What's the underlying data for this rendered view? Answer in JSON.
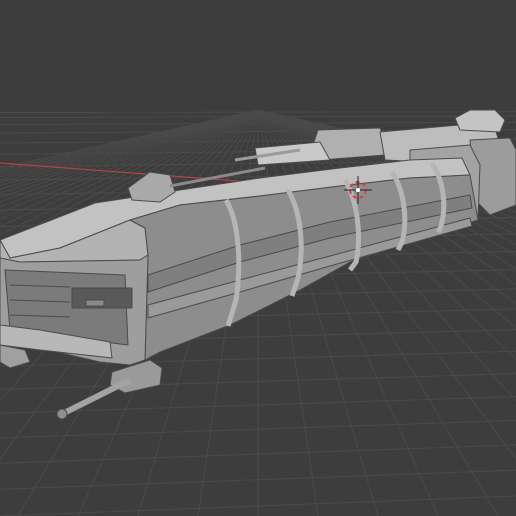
{
  "viewport": {
    "background_color": "#3d3d3d",
    "grid_color": "#4a4a4a",
    "x_axis_color": "#b8404a",
    "y_axis_color": "#5f8a2a"
  },
  "scene": {
    "object": "spaceship-hull-model",
    "hull_light": "#bdbdbd",
    "hull_mid": "#a8a8a8",
    "hull_dark": "#8a8a8a",
    "hull_shadow": "#6c6c6c",
    "line_color": "#4b4b4b"
  },
  "gizmos": {
    "cursor_3d": "3d-cursor-icon",
    "cursor_colors": [
      "#e23a3a",
      "#ffffff"
    ]
  }
}
